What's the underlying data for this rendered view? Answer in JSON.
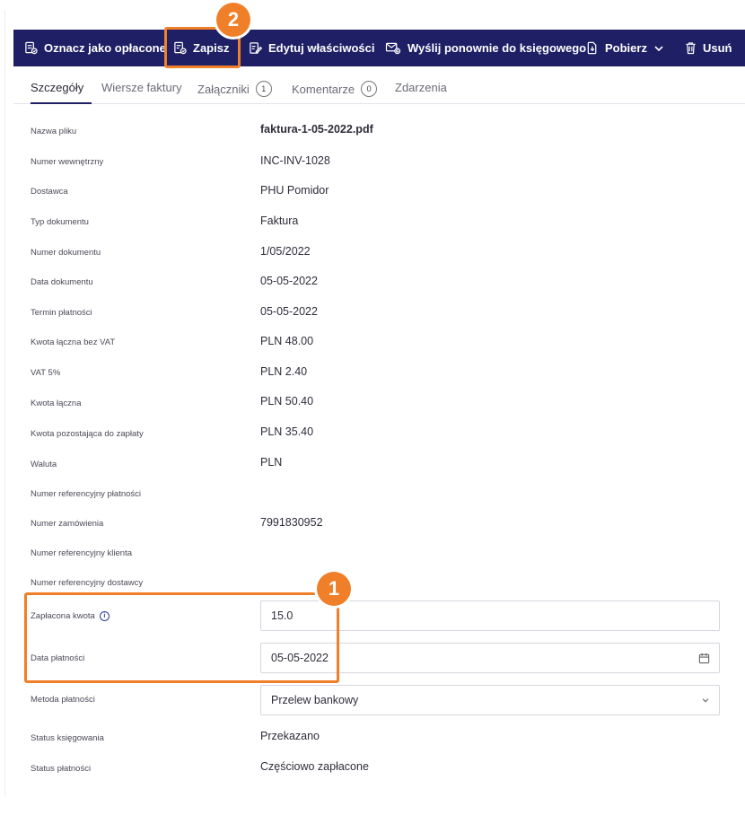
{
  "toolbar": {
    "mark_paid": "Oznacz jako opłacone",
    "save": "Zapisz",
    "edit_properties": "Edytuj właściwości",
    "resend": "Wyślij ponownie do księgowego",
    "download": "Pobierz",
    "delete": "Usuń"
  },
  "tabs": {
    "details": "Szczegóły",
    "invoice_lines": "Wiersze faktury",
    "attachments": "Załączniki",
    "attachments_count": "1",
    "comments": "Komentarze",
    "comments_count": "0",
    "events": "Zdarzenia"
  },
  "rows": {
    "file_name": {
      "label": "Nazwa pliku",
      "value": "faktura-1-05-2022.pdf"
    },
    "internal_number": {
      "label": "Numer wewnętrzny",
      "value": "INC-INV-1028"
    },
    "supplier": {
      "label": "Dostawca",
      "value": "PHU Pomidor"
    },
    "document_type": {
      "label": "Typ dokumentu",
      "value": "Faktura"
    },
    "document_number": {
      "label": "Numer dokumentu",
      "value": "1/05/2022"
    },
    "document_date": {
      "label": "Data dokumentu",
      "value": "05-05-2022"
    },
    "payment_due": {
      "label": "Termin płatności",
      "value": "05-05-2022"
    },
    "net_total": {
      "label": "Kwota łączna bez VAT",
      "value": "PLN 48.00"
    },
    "vat": {
      "label": "VAT 5%",
      "value": "PLN 2.40"
    },
    "gross_total": {
      "label": "Kwota łączna",
      "value": "PLN 50.40"
    },
    "remaining": {
      "label": "Kwota pozostająca do zapłaty",
      "value": "PLN 35.40"
    },
    "currency": {
      "label": "Waluta",
      "value": "PLN"
    },
    "payment_reference": {
      "label": "Numer referencyjny płatności",
      "value": ""
    },
    "order_number": {
      "label": "Numer zamówienia",
      "value": "7991830952"
    },
    "client_reference": {
      "label": "Numer referencyjny klienta",
      "value": ""
    },
    "supplier_reference": {
      "label": "Numer referencyjny dostawcy",
      "value": ""
    },
    "paid_amount": {
      "label": "Zapłacona kwota",
      "value": "15.0"
    },
    "payment_date": {
      "label": "Data płatności",
      "value": "05-05-2022"
    },
    "payment_method": {
      "label": "Metoda płatności",
      "value": "Przelew bankowy"
    },
    "booking_status": {
      "label": "Status księgowania",
      "value": "Przekazano"
    },
    "payment_status": {
      "label": "Status płatności",
      "value": "Częściowo zapłacone"
    }
  },
  "annotations": {
    "step1": "1",
    "step2": "2"
  },
  "colors": {
    "toolbar_bg": "#1f1f66",
    "highlight": "#f07f2a"
  },
  "icons": [
    "mark-paid-icon",
    "save-icon",
    "edit-icon",
    "email-icon",
    "download-icon",
    "chevron-down-icon",
    "trash-icon",
    "info-icon",
    "calendar-icon"
  ]
}
